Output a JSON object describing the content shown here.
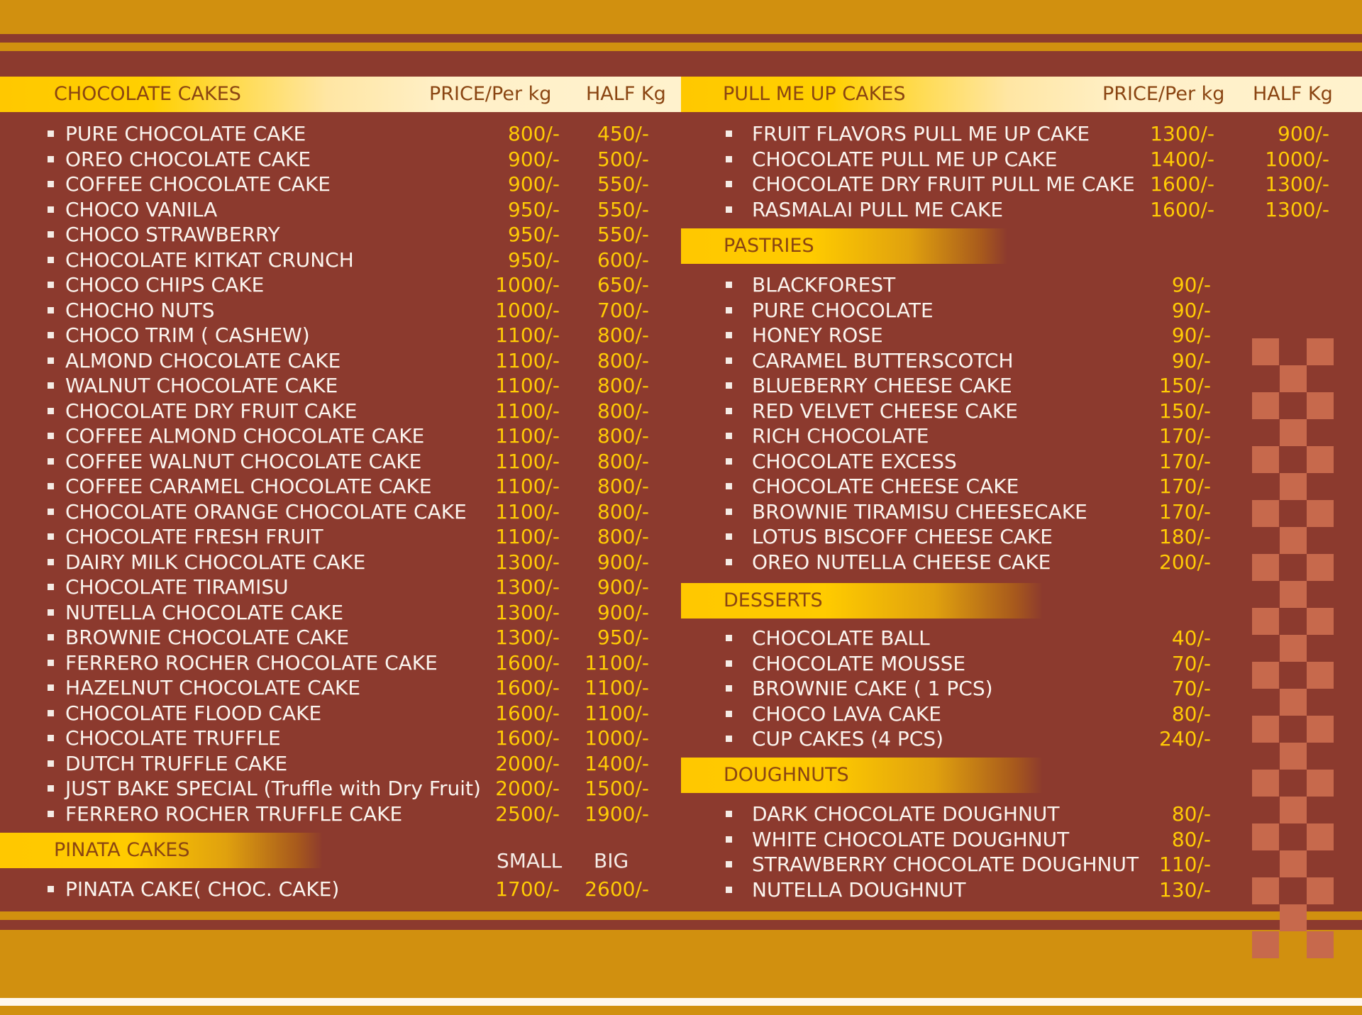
{
  "colors": {
    "background": "#8c3a2e",
    "gold": "#d1900f",
    "header_yellow": "#ffc800",
    "price": "#ffcb05",
    "text": "#fbf5ef",
    "accent_tile": "#c7694c"
  },
  "chocolate": {
    "title": "CHOCOLATE CAKES",
    "col_price": "PRICE/Per kg",
    "col_half": "HALF Kg",
    "items": [
      {
        "name": "PURE CHOCOLATE CAKE",
        "price": "800/-",
        "half": "450/-"
      },
      {
        "name": "OREO CHOCOLATE CAKE",
        "price": "900/-",
        "half": "500/-"
      },
      {
        "name": "COFFEE CHOCOLATE CAKE",
        "price": "900/-",
        "half": "550/-"
      },
      {
        "name": "CHOCO VANILA",
        "price": "950/-",
        "half": "550/-"
      },
      {
        "name": "CHOCO STRAWBERRY",
        "price": "950/-",
        "half": "550/-"
      },
      {
        "name": "CHOCOLATE KITKAT CRUNCH",
        "price": "950/-",
        "half": "600/-"
      },
      {
        "name": "CHOCO CHIPS CAKE",
        "price": "1000/-",
        "half": "650/-"
      },
      {
        "name": "CHOCHO NUTS",
        "price": "1000/-",
        "half": "700/-"
      },
      {
        "name": "CHOCO TRIM ( CASHEW)",
        "price": "1100/-",
        "half": "800/-"
      },
      {
        "name": "ALMOND CHOCOLATE CAKE",
        "price": "1100/-",
        "half": "800/-"
      },
      {
        "name": "WALNUT CHOCOLATE CAKE",
        "price": "1100/-",
        "half": "800/-"
      },
      {
        "name": "CHOCOLATE DRY FRUIT CAKE",
        "price": "1100/-",
        "half": "800/-"
      },
      {
        "name": "COFFEE ALMOND  CHOCOLATE CAKE",
        "price": "1100/-",
        "half": "800/-"
      },
      {
        "name": "COFFEE WALNUT CHOCOLATE CAKE",
        "price": "1100/-",
        "half": "800/-"
      },
      {
        "name": "COFFEE CARAMEL CHOCOLATE CAKE",
        "price": "1100/-",
        "half": "800/-"
      },
      {
        "name": "CHOCOLATE ORANGE CHOCOLATE CAKE",
        "price": "1100/-",
        "half": "800/-"
      },
      {
        "name": "CHOCOLATE FRESH FRUIT",
        "price": "1100/-",
        "half": "800/-"
      },
      {
        "name": "DAIRY MILK CHOCOLATE CAKE",
        "price": "1300/-",
        "half": "900/-"
      },
      {
        "name": "CHOCOLATE TIRAMISU",
        "price": "1300/-",
        "half": "900/-"
      },
      {
        "name": "NUTELLA CHOCOLATE CAKE",
        "price": "1300/-",
        "half": "900/-"
      },
      {
        "name": "BROWNIE CHOCOLATE CAKE",
        "price": "1300/-",
        "half": "950/-"
      },
      {
        "name": "FERRERO ROCHER CHOCOLATE CAKE",
        "price": "1600/-",
        "half": "1100/-"
      },
      {
        "name": "HAZELNUT CHOCOLATE CAKE",
        "price": "1600/-",
        "half": "1100/-"
      },
      {
        "name": "CHOCOLATE FLOOD CAKE",
        "price": "1600/-",
        "half": "1100/-"
      },
      {
        "name": "CHOCOLATE TRUFFLE",
        "price": "1600/-",
        "half": "1000/-"
      },
      {
        "name": "DUTCH TRUFFLE CAKE",
        "price": "2000/-",
        "half": "1400/-"
      },
      {
        "name": "JUST BAKE SPECIAL (Truffle with Dry Fruit)",
        "price": "2000/-",
        "half": "1500/-"
      },
      {
        "name": "FERRERO ROCHER TRUFFLE CAKE",
        "price": "2500/-",
        "half": "1900/-"
      }
    ]
  },
  "pinata": {
    "title": "PINATA CAKES",
    "col_small": "SMALL",
    "col_big": "BIG",
    "items": [
      {
        "name": "PINATA CAKE( CHOC. CAKE)",
        "small": "1700/-",
        "big": "2600/-"
      }
    ]
  },
  "pullmeup": {
    "title": "PULL ME UP CAKES",
    "col_price": "PRICE/Per kg",
    "col_half": "HALF Kg",
    "items": [
      {
        "name": "FRUIT FLAVORS PULL ME UP CAKE",
        "price": "1300/-",
        "half": "900/-"
      },
      {
        "name": "CHOCOLATE PULL ME UP CAKE",
        "price": "1400/-",
        "half": "1000/-"
      },
      {
        "name": "CHOCOLATE DRY FRUIT PULL ME CAKE",
        "price": "1600/-",
        "half": "1300/-"
      },
      {
        "name": "RASMALAI PULL ME CAKE",
        "price": "1600/-",
        "half": "1300/-"
      }
    ]
  },
  "pastries": {
    "title": "PASTRIES",
    "items": [
      {
        "name": "BLACKFOREST",
        "price": "90/-"
      },
      {
        "name": "PURE CHOCOLATE",
        "price": "90/-"
      },
      {
        "name": "HONEY ROSE",
        "price": "90/-"
      },
      {
        "name": "CARAMEL BUTTERSCOTCH",
        "price": "90/-"
      },
      {
        "name": "BLUEBERRY CHEESE CAKE",
        "price": "150/-"
      },
      {
        "name": "RED VELVET CHEESE CAKE",
        "price": "150/-"
      },
      {
        "name": "RICH CHOCOLATE",
        "price": "170/-"
      },
      {
        "name": "CHOCOLATE EXCESS",
        "price": "170/-"
      },
      {
        "name": "CHOCOLATE CHEESE CAKE",
        "price": "170/-"
      },
      {
        "name": "BROWNIE TIRAMISU CHEESECAKE",
        "price": "170/-"
      },
      {
        "name": "LOTUS BISCOFF CHEESE CAKE",
        "price": "180/-"
      },
      {
        "name": "OREO NUTELLA CHEESE CAKE",
        "price": "200/-"
      }
    ]
  },
  "desserts": {
    "title": "DESSERTS",
    "items": [
      {
        "name": "CHOCOLATE BALL",
        "price": "40/-"
      },
      {
        "name": "CHOCOLATE MOUSSE",
        "price": "70/-"
      },
      {
        "name": "BROWNIE CAKE ( 1 PCS)",
        "price": "70/-"
      },
      {
        "name": "CHOCO LAVA CAKE",
        "price": "80/-"
      },
      {
        "name": "CUP CAKES (4 PCS)",
        "price": "240/-"
      }
    ]
  },
  "doughnuts": {
    "title": "DOUGHNUTS",
    "items": [
      {
        "name": "DARK CHOCOLATE DOUGHNUT",
        "price": "80/-"
      },
      {
        "name": "WHITE CHOCOLATE DOUGHNUT",
        "price": "80/-"
      },
      {
        "name": "STRAWBERRY CHOCOLATE DOUGHNUT",
        "price": "110/-"
      },
      {
        "name": "NUTELLA DOUGHNUT",
        "price": "130/-"
      }
    ]
  }
}
